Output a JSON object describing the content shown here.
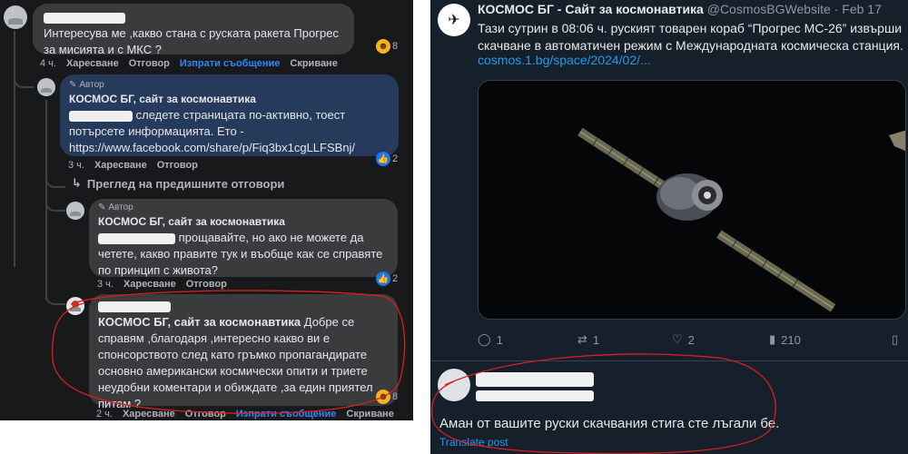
{
  "facebook": {
    "comment1": {
      "text": "Интересува ме ,какво стана с руската ракета Прогрес за мисията и с МКС ?",
      "reaction_count": "8",
      "time": "4 ч.",
      "actions": [
        "Харесване",
        "Отговор",
        "Изпрати съобщение",
        "Скриване"
      ]
    },
    "reply1": {
      "author_badge": "Автор",
      "author": "КОСМОС БГ, сайт за космонавтика",
      "text": "следете страницата по-активно, тоест потърсете информацията. Ето -",
      "link": "https://www.facebook.com/share/p/Fiq3bx1cgLLFSBnj/",
      "reaction_count": "2",
      "time": "3 ч.",
      "actions": [
        "Харесване",
        "Отговор"
      ]
    },
    "prev_replies": "Преглед на предишните отговори",
    "reply2": {
      "author_badge": "Автор",
      "author": "КОСМОС БГ, сайт за космонавтика",
      "text": "прощавайте, но ако не можете да четете, какво правите тук и въобще как се справяте по принцип с живота?",
      "reaction_count": "2",
      "time": "3 ч.",
      "actions": [
        "Харесване",
        "Отговор"
      ]
    },
    "reply3": {
      "author": "КОСМОС БГ, сайт за космонавтика",
      "text": "Добре се справям ,благодаря ,интересно какво ви е спонсорството след като гръмко пропагандирате основно американски космически опити и триете неудобни коментари и обиждате ,за един приятел питам ?",
      "reaction_count": "8",
      "time": "2 ч.",
      "actions": [
        "Харесване",
        "Отговор",
        "Изпрати съобщение",
        "Скриване"
      ]
    }
  },
  "twitter": {
    "author_name": "КОСМОС БГ - Сайт за космонавтика",
    "handle_date": "@CosmosBGWebsite · Feb 17",
    "text": "Тази сутрин в 08:06 ч. руският товарен кораб “Прогрес МС-26” извърши скачване в автоматичен режим с Международната космическа станция.",
    "link": "cosmos.1.bg/space/2024/02/...",
    "stats": {
      "replies": "1",
      "reposts": "1",
      "likes": "2",
      "views": "210"
    },
    "reply_text": "Аман от вашите руски скачвания стига сте лъгали бе.",
    "translate": "Translate post"
  },
  "colors": {
    "fb_bg": "#18191a",
    "fb_bubble": "#3a3b3c",
    "fb_bubble_highlight": "#263a5c",
    "fb_link": "#2d88ff",
    "tw_bg": "#15202b",
    "tw_link": "#1d9bf0",
    "annotation": "#d92020"
  }
}
